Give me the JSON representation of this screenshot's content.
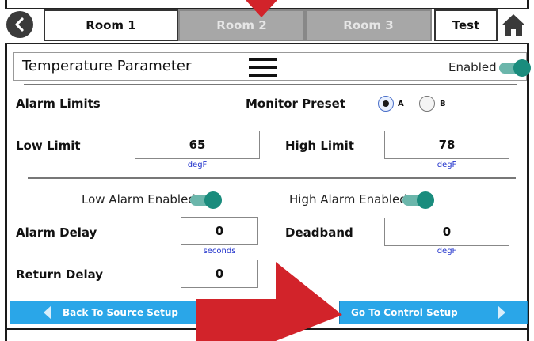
{
  "tabs": [
    {
      "label": "Room 1",
      "state": "active"
    },
    {
      "label": "Room 2",
      "state": "inactive"
    },
    {
      "label": "Room 3",
      "state": "inactive"
    },
    {
      "label": "Test",
      "state": "active"
    }
  ],
  "header": {
    "title": "Temperature Parameter",
    "enabled_label": "Enabled",
    "enabled": true
  },
  "alarm_limits": {
    "title": "Alarm Limits",
    "monitor_preset_label": "Monitor Preset",
    "preset_options": [
      "A",
      "B"
    ],
    "preset_selected": "A",
    "low_limit_label": "Low Limit",
    "low_limit_value": "65",
    "low_limit_unit": "degF",
    "high_limit_label": "High Limit",
    "high_limit_value": "78",
    "high_limit_unit": "degF"
  },
  "alarms": {
    "low_alarm_label": "Low Alarm Enabled",
    "low_alarm_enabled": true,
    "high_alarm_label": "High Alarm Enabled",
    "high_alarm_enabled": true,
    "alarm_delay_label": "Alarm Delay",
    "alarm_delay_value": "0",
    "alarm_delay_unit": "seconds",
    "deadband_label": "Deadband",
    "deadband_value": "0",
    "deadband_unit": "degF",
    "return_delay_label": "Return Delay",
    "return_delay_value": "0"
  },
  "nav": {
    "back_label": "Back To Source Setup",
    "forward_label": "Go To Control Setup"
  },
  "colors": {
    "accent_blue": "#2aa6e8",
    "toggle_teal": "#1a8c7d",
    "annotation_red": "#d2232a",
    "unit_text": "#2233cc"
  }
}
